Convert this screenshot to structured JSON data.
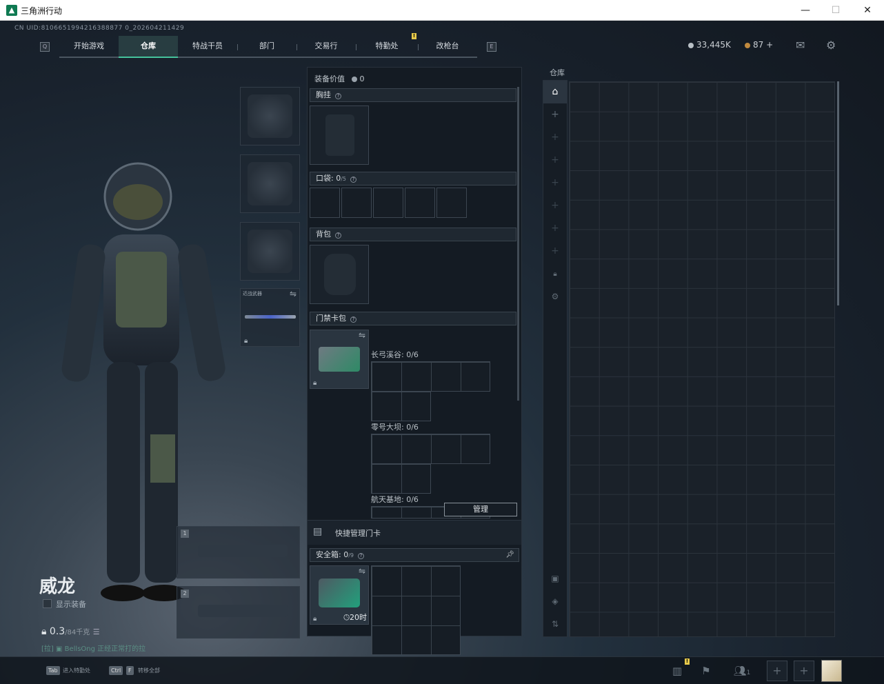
{
  "window": {
    "title": "三角洲行动",
    "minimize": "—",
    "maximize": "☐",
    "close": "✕"
  },
  "uid": "CN UID:8106651994216388877 0_202604211429",
  "nav": {
    "tabs": [
      "开始游戏",
      "仓库",
      "特战干员",
      "部门",
      "交易行",
      "特勤处",
      "改枪台"
    ],
    "active": 1,
    "left_key": "Q",
    "right_key": "E",
    "badge": "!"
  },
  "currency": {
    "coins": "33,445K",
    "coins_color": "#b9c0c6",
    "tickets": "87",
    "tickets_color": "#c08a3e",
    "add": "+"
  },
  "character": {
    "name": "威龙",
    "show_equipment": "显示装备",
    "weight": "0.3",
    "weight_max": "/84千克",
    "status_prefix": "[拉]",
    "status_user": "BellsOng",
    "status_text": "正经正常打的拉",
    "melee_label": "近战武器",
    "slot_primary_1": "1",
    "slot_primary_2": "2"
  },
  "equipment": {
    "value_label": "装备价值",
    "value": "0",
    "chest_rig": "胸挂",
    "pockets": "口袋:",
    "pockets_value": "0",
    "pockets_max": "/5",
    "backpack": "背包",
    "keycard_bag": "门禁卡包",
    "keycards": [
      {
        "name": "长弓溪谷:",
        "count": "0/6"
      },
      {
        "name": "零号大坝:",
        "count": "0/6"
      },
      {
        "name": "航天基地:",
        "count": "0/6"
      }
    ],
    "quick_manage": "快捷管理门卡",
    "manage_button": "管理",
    "safebox": "安全箱:",
    "safebox_value": "0",
    "safebox_max": "/9",
    "safebox_timer": "20时"
  },
  "warehouse": {
    "label": "仓库"
  },
  "bottom": {
    "tab_key": "Tab",
    "tab_hint": "进入特勤处",
    "ctrl_key": "Ctrl",
    "f_key": "F",
    "ctrl_hint": "转移全部",
    "friends": "1",
    "badge": "!"
  },
  "colors": {
    "accent": "#46c49c",
    "background": "#121820"
  }
}
